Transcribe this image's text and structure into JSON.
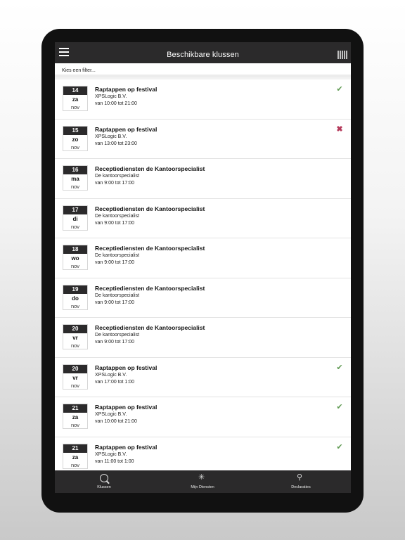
{
  "header": {
    "title": "Beschikbare klussen"
  },
  "filter": {
    "label": "Kies een filter..."
  },
  "jobs": [
    {
      "day": "14",
      "weekday": "za",
      "month": "nov",
      "title": "Raptappen op festival",
      "company": "XPSLogic B.V.",
      "time": "van 10:00 tot 21:00",
      "status": "accepted"
    },
    {
      "day": "15",
      "weekday": "zo",
      "month": "nov",
      "title": "Raptappen op festival",
      "company": "XPSLogic B.V.",
      "time": "van 13:00 tot 23:00",
      "status": "declined"
    },
    {
      "day": "16",
      "weekday": "ma",
      "month": "nov",
      "title": "Receptiediensten de Kantoorspecialist",
      "company": "De kantoorspecialist",
      "time": "van 9:00 tot 17:00",
      "status": ""
    },
    {
      "day": "17",
      "weekday": "di",
      "month": "nov",
      "title": "Receptiediensten de Kantoorspecialist",
      "company": "De kantoorspecialist",
      "time": "van 9:00 tot 17:00",
      "status": ""
    },
    {
      "day": "18",
      "weekday": "wo",
      "month": "nov",
      "title": "Receptiediensten de Kantoorspecialist",
      "company": "De kantoorspecialist",
      "time": "van 9:00 tot 17:00",
      "status": ""
    },
    {
      "day": "19",
      "weekday": "do",
      "month": "nov",
      "title": "Receptiediensten de Kantoorspecialist",
      "company": "De kantoorspecialist",
      "time": "van 9:00 tot 17:00",
      "status": ""
    },
    {
      "day": "20",
      "weekday": "vr",
      "month": "nov",
      "title": "Receptiediensten de Kantoorspecialist",
      "company": "De kantoorspecialist",
      "time": "van 9:00 tot 17:00",
      "status": ""
    },
    {
      "day": "20",
      "weekday": "vr",
      "month": "nov",
      "title": "Raptappen op festival",
      "company": "XPSLogic B.V.",
      "time": "van 17:00 tot 1:00",
      "status": "accepted"
    },
    {
      "day": "21",
      "weekday": "za",
      "month": "nov",
      "title": "Raptappen op festival",
      "company": "XPSLogic B.V.",
      "time": "van 10:00 tot 21:00",
      "status": "accepted"
    },
    {
      "day": "21",
      "weekday": "za",
      "month": "nov",
      "title": "Raptappen op festival",
      "company": "XPSLogic B.V.",
      "time": "van 11:00 tot 1:00",
      "status": "accepted"
    }
  ],
  "icons": {
    "accepted": "✔",
    "declined": "✖"
  },
  "colors": {
    "bar": "#2b2a2b",
    "accepted": "#5f9a52",
    "declined": "#b53a5b"
  },
  "tabs": [
    {
      "label": "Klussen",
      "icon": "search-icon"
    },
    {
      "label": "Mijn Diensten",
      "icon": "star-icon"
    },
    {
      "label": "Declaraties",
      "icon": "receipt-icon"
    }
  ]
}
